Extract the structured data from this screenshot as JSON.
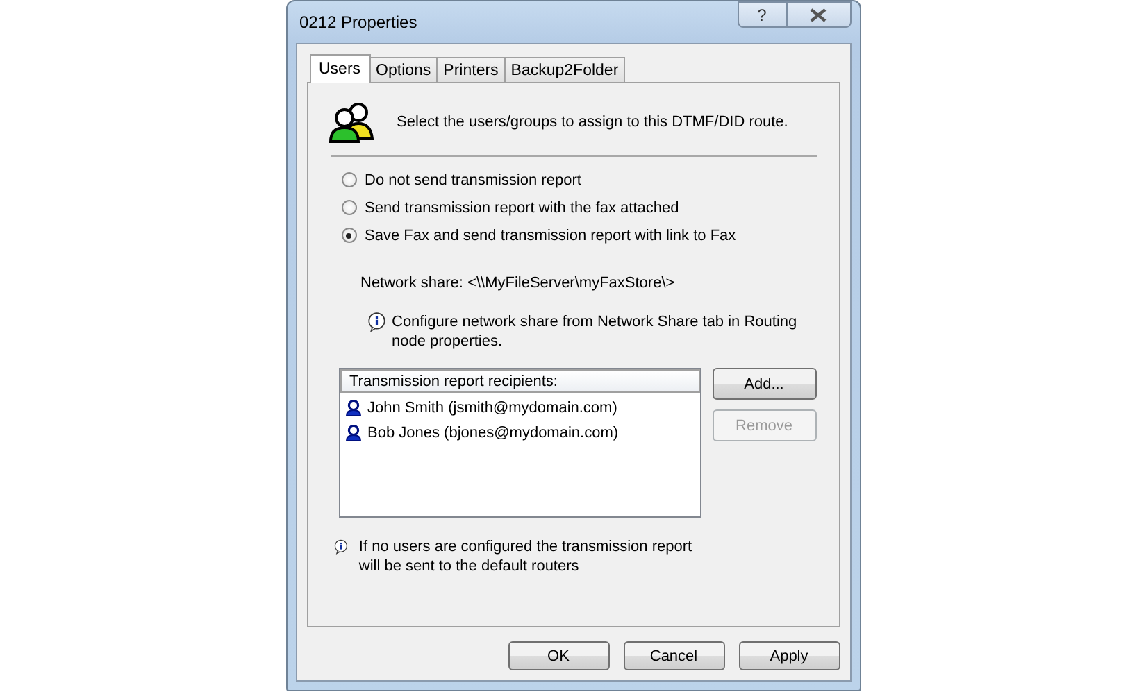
{
  "window": {
    "title": "0212 Properties",
    "help_button": "?"
  },
  "tabs": [
    {
      "label": "Users",
      "selected": true
    },
    {
      "label": "Options",
      "selected": false
    },
    {
      "label": "Printers",
      "selected": false
    },
    {
      "label": "Backup2Folder",
      "selected": false
    }
  ],
  "intro": "Select the users/groups to assign to this DTMF/DID route.",
  "report_options": [
    {
      "label": "Do not send transmission report",
      "selected": false
    },
    {
      "label": "Send transmission report with the fax attached",
      "selected": false
    },
    {
      "label": "Save Fax and send transmission report with link to Fax",
      "selected": true
    }
  ],
  "network_share": "Network share: <\\\\MyFileServer\\myFaxStore\\>",
  "share_note": "Configure network share from Network Share tab in Routing node properties.",
  "recipients": {
    "header": "Transmission report recipients:",
    "items": [
      "John Smith (jsmith@mydomain.com)",
      "Bob Jones (bjones@mydomain.com)"
    ]
  },
  "recipient_buttons": [
    {
      "label": "Add...",
      "disabled": false
    },
    {
      "label": "Remove",
      "disabled": true
    }
  ],
  "default_note": "If no users are configured the transmission report will be sent to the default routers",
  "buttons": [
    {
      "label": "OK",
      "disabled": false
    },
    {
      "label": "Cancel",
      "disabled": false
    },
    {
      "label": "Apply",
      "disabled": false
    }
  ]
}
